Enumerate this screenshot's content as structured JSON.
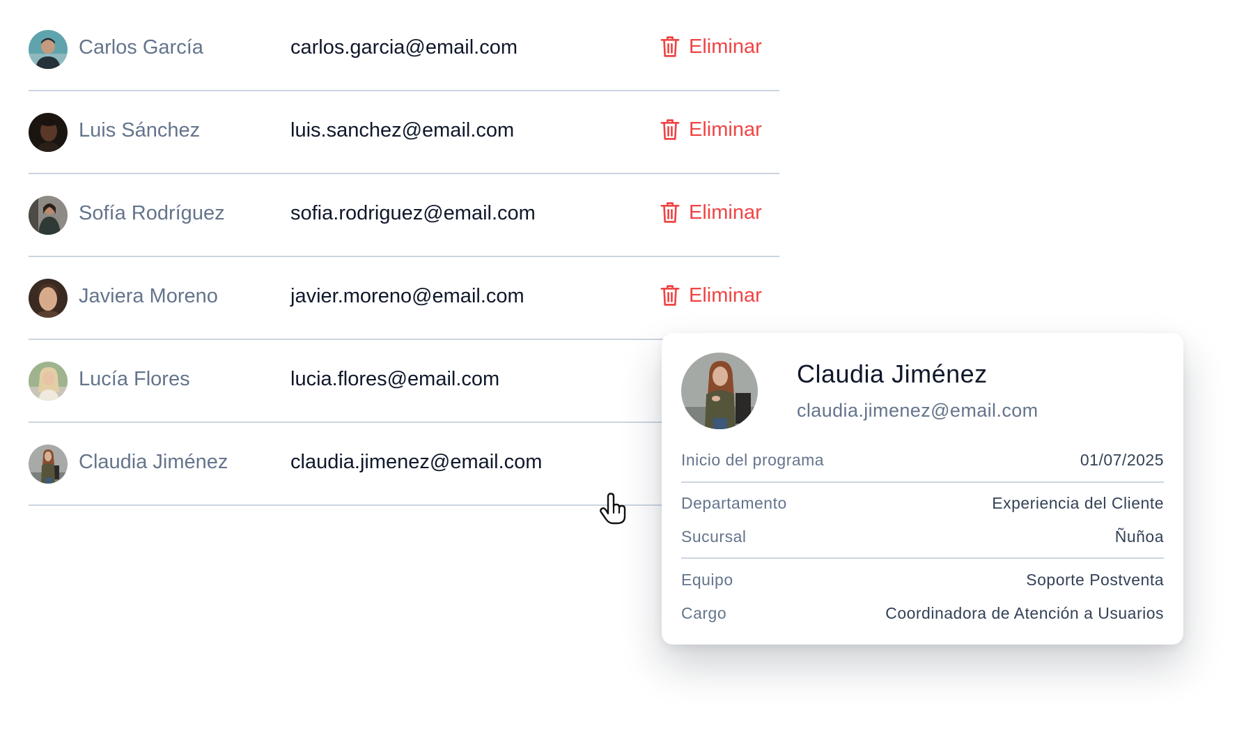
{
  "users": [
    {
      "name": "Carlos García",
      "email": "carlos.garcia@email.com",
      "delete_label": "Eliminar"
    },
    {
      "name": "Luis Sánchez",
      "email": "luis.sanchez@email.com",
      "delete_label": "Eliminar"
    },
    {
      "name": "Sofía Rodríguez",
      "email": "sofia.rodriguez@email.com",
      "delete_label": "Eliminar"
    },
    {
      "name": "Javiera Moreno",
      "email": "javier.moreno@email.com",
      "delete_label": "Eliminar"
    },
    {
      "name": "Lucía Flores",
      "email": "lucia.flores@email.com"
    },
    {
      "name": "Claudia Jiménez",
      "email": "claudia.jimenez@email.com"
    }
  ],
  "profile_card": {
    "name": "Claudia Jiménez",
    "email": "claudia.jimenez@email.com",
    "details": [
      {
        "label": "Inicio del programa",
        "value": "01/07/2025"
      },
      {
        "label": "Departamento",
        "value": "Experiencia del Cliente"
      },
      {
        "label": "Sucursal",
        "value": "Ñuñoa"
      },
      {
        "label": "Equipo",
        "value": "Soporte Postventa"
      },
      {
        "label": "Cargo",
        "value": "Coordinadora de Atención a Usuarios"
      }
    ]
  },
  "icons": {
    "delete": "trash-icon",
    "cursor": "hand-pointer-icon",
    "avatar": "user-photo"
  },
  "colors": {
    "danger": "#ef4444",
    "name_text": "#64748b",
    "email_text": "#0f172a",
    "divider": "#cbd5e1",
    "card_background": "#ffffff"
  }
}
